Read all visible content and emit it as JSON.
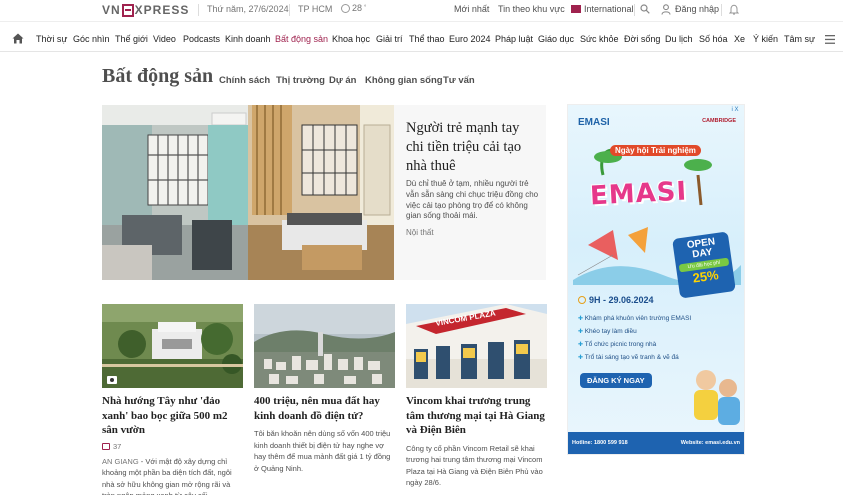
{
  "topbar": {
    "logo_left": "VN",
    "logo_right": "XPRESS",
    "date": "Thứ năm, 27/6/2024",
    "city": "TP HCM",
    "temperature": "28",
    "temp_unit": "°",
    "latest": "Mới nhất",
    "local_news": "Tin theo khu vực",
    "international": "International",
    "login": "Đăng nhập"
  },
  "nav": {
    "items": [
      "Thời sự",
      "Góc nhìn",
      "Thế giới",
      "Video",
      "Podcasts",
      "Kinh doanh",
      "Bất động sản",
      "Khoa học",
      "Giải trí",
      "Thể thao",
      "Euro 2024",
      "Pháp luật",
      "Giáo dục",
      "Sức khỏe",
      "Đời sống",
      "Du lịch",
      "Số hóa",
      "Xe",
      "Ý kiến",
      "Tâm sự"
    ],
    "active": "Bất động sản"
  },
  "section": {
    "title": "Bất động sản",
    "subnav": [
      "Chính sách",
      "Thị trường",
      "Dự án",
      "Không gian sống",
      "Tư vấn"
    ]
  },
  "featured": {
    "title": "Người trẻ mạnh tay chi tiền triệu cải tạo nhà thuê",
    "description": "Dù chỉ thuê ở tạm, nhiều người trẻ vẫn sẵn sàng chi chục triệu đồng cho việc cải tạo phòng trọ để có không gian sống thoải mái.",
    "tag": "Nội thất"
  },
  "cards": [
    {
      "title": "Nhà hướng Tây như 'đảo xanh' bao bọc giữa 500 m2 sân vườn",
      "comments": "37",
      "location": "AN GIANG",
      "description": " - Với mật độ xây dựng chỉ khoảng một phần ba diện tích đất, ngôi nhà sở hữu không gian mở rộng rãi và tràn ngập mảng xanh từ cây cối."
    },
    {
      "title": "400 triệu, nên mua đất hay kinh doanh đồ điện tử?",
      "description": "Tôi băn khoăn nên dùng số vốn 400 triệu kinh doanh thiết bị điện tử hay nghe vợ hay thêm để mua mảnh đất giá 1 tỷ đồng ở Quảng Ninh."
    },
    {
      "title": "Vincom khai trương trung tâm thương mại tại Hà Giang và Điện Biên",
      "description": "Công ty cổ phần Vincom Retail sẽ khai trương hai trung tâm thương mại Vincom Plaza tại Hà Giang và Điện Biên Phủ vào ngày 28/6.",
      "sign": "VINCOM PLAZA"
    }
  ],
  "ad": {
    "close": "i X",
    "brand": "EMASI",
    "partner": "CAMBRIDGE",
    "headline_small": "Ngày hội Trải nghiệm",
    "headline": "EMASI",
    "open_day_1": "OPEN",
    "open_day_2": "DAY",
    "open_offer": "Ưu đãi học phí",
    "open_discount": "25%",
    "date": "9H - 29.06.2024",
    "bullets": [
      "Khám phá khuôn viên trường EMASI",
      "Khéo tay làm diều",
      "Tổ chức picnic trong nhà",
      "Trổ tài sáng tạo vẽ tranh & vẽ đá"
    ],
    "cta": "ĐĂNG KÝ NGAY",
    "hotline": "Hotline: 1800 599 918",
    "website": "Website: emasi.edu.vn"
  }
}
